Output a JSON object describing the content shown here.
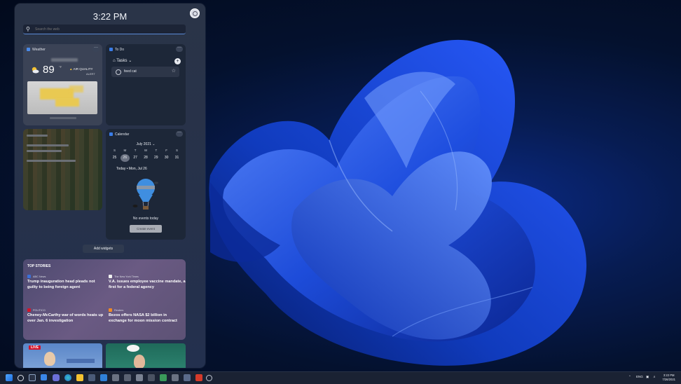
{
  "widgets_panel": {
    "time": "3:22 PM",
    "search_placeholder": "Search the web",
    "add_widgets_label": "Add widgets"
  },
  "weather": {
    "title": "Weather",
    "temperature": "89",
    "unit": "°F",
    "air_quality": "AIR QUALITY",
    "alert": "ALERT"
  },
  "todo": {
    "title": "To Do",
    "list_name": "Tasks",
    "tasks": [
      "feed cat"
    ]
  },
  "calendar": {
    "title": "Calendar",
    "month": "July 2021",
    "weekdays": [
      "S",
      "M",
      "T",
      "W",
      "T",
      "F",
      "S"
    ],
    "dates": [
      "25",
      "26",
      "27",
      "28",
      "29",
      "30",
      "31"
    ],
    "selected_date": "26",
    "today_label": "Today • Mon, Jul 26",
    "no_events": "No events today",
    "create_event": "Create event"
  },
  "top_stories": {
    "heading": "TOP STORIES",
    "stories": [
      {
        "source": "ABC News",
        "headline": "Trump inauguration head pleads not guilty to being foreign agent",
        "color": "#3a6fd8"
      },
      {
        "source": "The New York Times",
        "headline": "V.A. issues employee vaccine mandate, a first for a federal agency",
        "color": "#f0f0f0"
      },
      {
        "source": "POLITICO",
        "headline": "Cheney-McCarthy war of words heats up over Jan. 6 investigation",
        "color": "#d4142a"
      },
      {
        "source": "Reuters",
        "headline": "Bezos offers NASA $2 billion in exchange for moon mission contract",
        "color": "#f08a24"
      }
    ]
  },
  "news_thumbnails": {
    "live_badge": "LIVE"
  },
  "taskbar": {
    "language": "ENG",
    "time": "3:22 PM",
    "date": "7/26/2021"
  },
  "colors": {
    "accent": "#5a8bd8",
    "wallpaper_bloom": "#1f55e6"
  }
}
